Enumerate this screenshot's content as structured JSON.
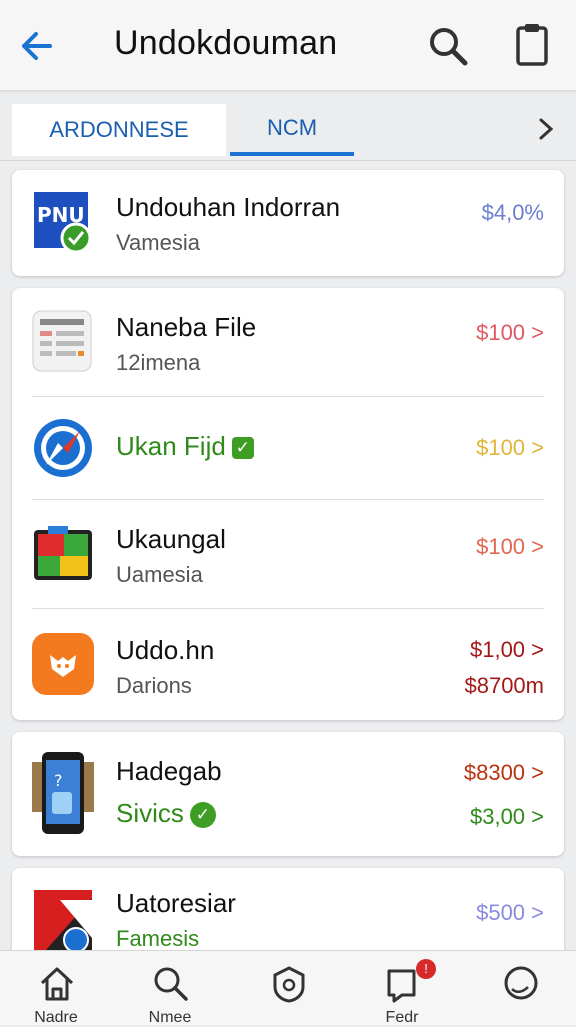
{
  "header": {
    "title": "Undokdouman",
    "back_icon": "arrow-left-icon",
    "search_icon": "search-icon",
    "clipboard_icon": "clipboard-icon"
  },
  "tabs": {
    "items": [
      {
        "label": "ARDONNESE",
        "selected": false
      },
      {
        "label": "NCM",
        "selected": true
      }
    ],
    "more_icon": "chevron-right-icon"
  },
  "list": {
    "items": [
      {
        "name": "Undouhan Indorran",
        "sub": "Vamesia",
        "price": "$4,0%",
        "price_color": "#6b7fd0",
        "icon": "app-blue-check-icon"
      },
      {
        "name": "Naneba File",
        "sub": "12imena",
        "price": "$100 >",
        "price_color": "#e05a62",
        "icon": "document-icon"
      },
      {
        "name": "Ukan Fijd",
        "sub": "",
        "price": "$100 >",
        "price_color": "#e0b63a",
        "icon": "compass-icon",
        "name_color": "#2f8a1a"
      },
      {
        "name": "Ukaungal",
        "sub": "Uamesia",
        "price": "$100 >",
        "price_color": "#e06850",
        "icon": "colorful-blocks-icon"
      },
      {
        "name": "Uddo.hn",
        "sub": "Darions",
        "price": "$1,00 >",
        "price2": "$8700m",
        "price_color": "#a31818",
        "icon": "orange-fox-icon"
      },
      {
        "name": "Hadegab",
        "sub": "Sivics",
        "price": "$8300 >",
        "price2": "$3,00 >",
        "price_color": "#b8340f",
        "price2_color": "#2f8a1a",
        "icon": "phone-icon",
        "sub_color": "#2f8a1a"
      },
      {
        "name": "Uatoresiar",
        "sub": "Famesis",
        "price": "$500 >",
        "price_color": "#8a8be0",
        "icon": "red-flag-icon",
        "sub_color": "#2f8a1a"
      }
    ]
  },
  "bottom_nav": {
    "items": [
      {
        "label": "Nadre",
        "icon": "home-icon"
      },
      {
        "label": "Nmee",
        "icon": "search-icon"
      },
      {
        "label": "",
        "icon": "shield-icon"
      },
      {
        "label": "Fedr",
        "icon": "bookmark-icon",
        "badge": "!"
      },
      {
        "label": "",
        "icon": "chat-icon"
      }
    ]
  }
}
